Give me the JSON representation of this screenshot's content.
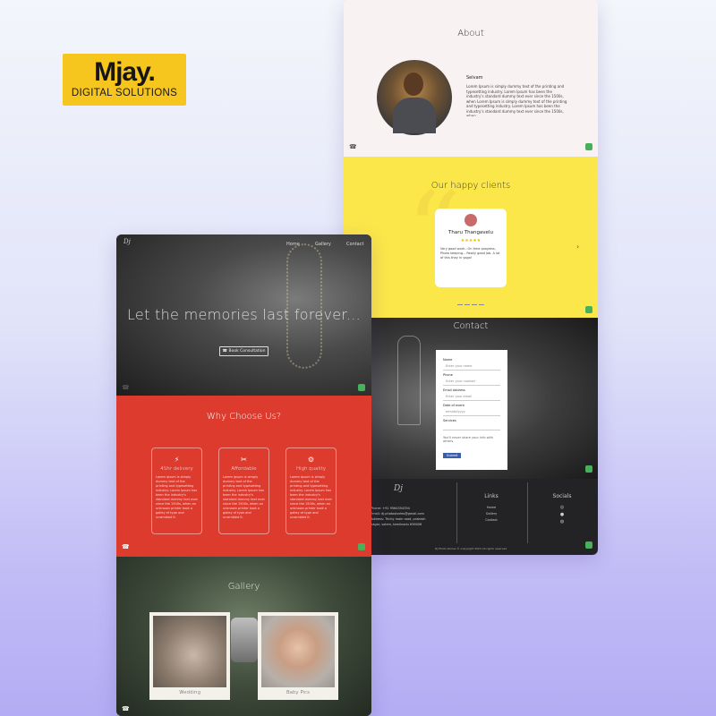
{
  "brand": {
    "name": "Mjay.",
    "tagline": "DIGITAL SOLUTIONS"
  },
  "hero": {
    "nav": [
      "Home",
      "Gallery",
      "Contact"
    ],
    "title": "Let the memories last forever...",
    "cta": "Book Consultation"
  },
  "why": {
    "title": "Why Choose Us?",
    "features": [
      {
        "icon": "lightning-icon",
        "title": "4Shr delivery",
        "text": "Lorem ipsum is simply dummy text of the printing and typesetting industry. Lorem Ipsum has been the industry's standard dummy text ever since the 1500s, when an unknown printer took a galley of type and scrambled it."
      },
      {
        "icon": "tools-icon",
        "title": "Affordable",
        "text": "Lorem ipsum is simply dummy text of the printing and typesetting industry. Lorem Ipsum has been the industry's standard dummy text ever since the 1500s, when an unknown printer took a galley of type and scrambled it."
      },
      {
        "icon": "gear-icon",
        "title": "High quality",
        "text": "Lorem ipsum is simply dummy text of the printing and typesetting industry. Lorem Ipsum has been the industry's standard dummy text ever since the 1500s, when an unknown printer took a galley of type and scrambled it."
      }
    ]
  },
  "gallery": {
    "title": "Gallery",
    "items": [
      "Wedding",
      "Baby Pics"
    ]
  },
  "about": {
    "title": "About",
    "name": "Selvam",
    "text": "Lorem Ipsum is simply dummy text of the printing and typesetting industry. Lorem Ipsum has been the industry's standard dummy text ever since the 1500s, when Lorem Ipsum is simply dummy text of the printing and typesetting industry. Lorem Ipsum has been the industry's standard dummy text ever since the 1500s, when"
  },
  "clients": {
    "title": "Our happy clients",
    "name": "Tharu Thangavelu",
    "stars": "★★★★★",
    "quote": "Very good work...On time progress, Photo keeping... Really good job. A lot of this they in yoga!"
  },
  "contact": {
    "title": "Contact",
    "fields": [
      {
        "label": "Name",
        "placeholder": "Enter your name"
      },
      {
        "label": "Phone",
        "placeholder": "Enter your number"
      },
      {
        "label": "Email Address",
        "placeholder": "Enter your email"
      },
      {
        "label": "Date of event",
        "placeholder": "mm/dd/yyyy"
      },
      {
        "label": "Services",
        "placeholder": ""
      }
    ],
    "note": "You'll never share your info with others",
    "submit": "Submit"
  },
  "footer": {
    "phone": "Phone: +91 9564354354",
    "email": "Email: dj.photostories@gmail.com",
    "address": "Address: Trichy main road, prakash nagar, salem, tamilnadu 636006",
    "links_title": "Links",
    "links": [
      "Home",
      "Gallery",
      "Contact"
    ],
    "socials_title": "Socials",
    "copyright": "DJ Photo stories © Copyright 2023 All rights reserved"
  },
  "colors": {
    "brand_yellow": "#f6c61e",
    "why_red": "#de3b2f",
    "clients_yellow": "#fce74a",
    "whatsapp": "#47b05a"
  }
}
